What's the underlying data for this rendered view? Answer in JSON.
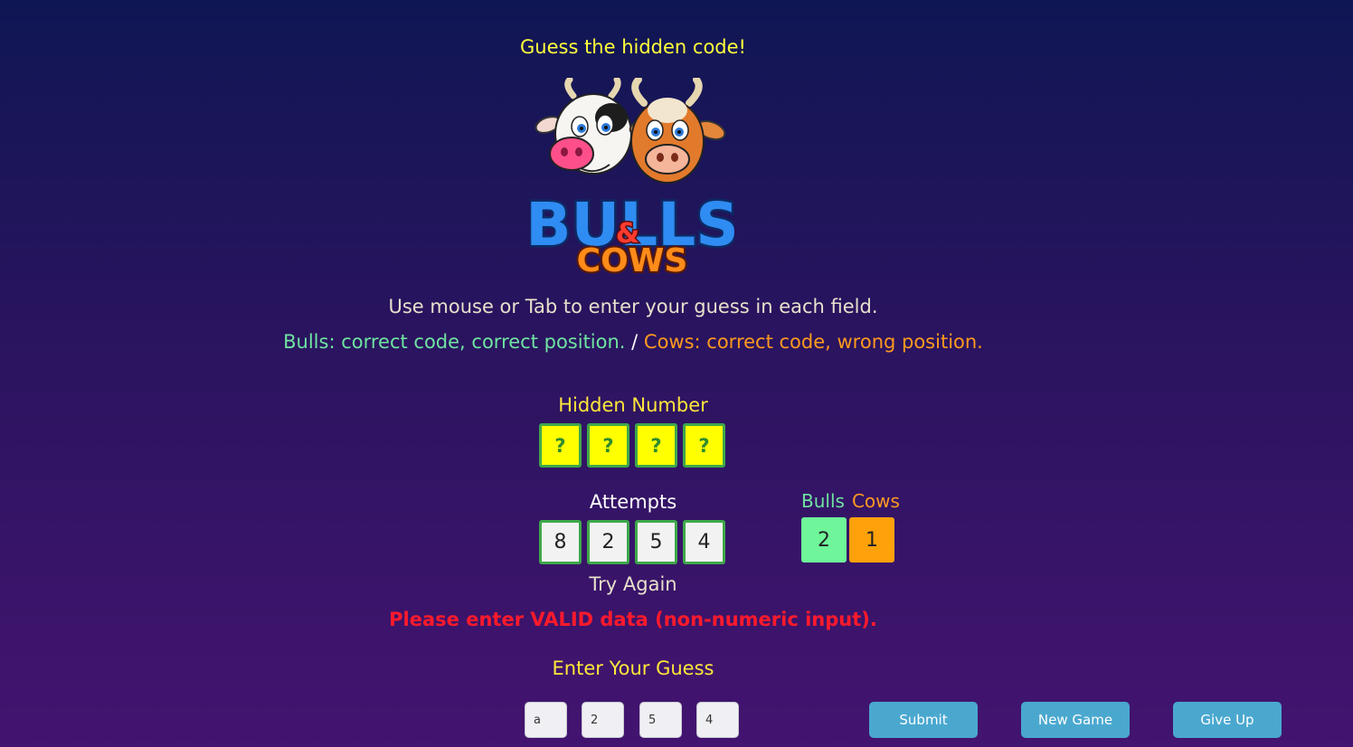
{
  "header": {
    "tagline": "Guess the hidden code!"
  },
  "logo": {
    "top_word": "BULLS",
    "ampersand": "&",
    "bottom_word": "COWS"
  },
  "instructions": {
    "line1": "Use mouse or Tab to enter your guess in each field.",
    "bulls_text": "Bulls: correct code, correct position.",
    "separator": " / ",
    "cows_text": "Cows: correct code, wrong position."
  },
  "hidden": {
    "title": "Hidden Number",
    "digits": [
      "?",
      "?",
      "?",
      "?"
    ]
  },
  "attempts": {
    "title": "Attempts",
    "rows": [
      {
        "digits": [
          "8",
          "2",
          "5",
          "4"
        ],
        "bulls": "2",
        "cows": "1"
      }
    ]
  },
  "score_labels": {
    "bulls": "Bulls",
    "cows": "Cows"
  },
  "status": {
    "try_again": "Try Again",
    "error": "Please enter VALID data (non-numeric input)."
  },
  "guess": {
    "title": "Enter Your Guess",
    "values": [
      "a",
      "2",
      "5",
      "4"
    ]
  },
  "buttons": {
    "submit": "Submit",
    "new_game": "New Game",
    "give_up": "Give Up"
  },
  "colors": {
    "bulls": "#6ff59a",
    "cows": "#ffa10a",
    "hidden_box": "#ffff00",
    "error": "#ff1a2c",
    "button": "#4aa8cf"
  }
}
